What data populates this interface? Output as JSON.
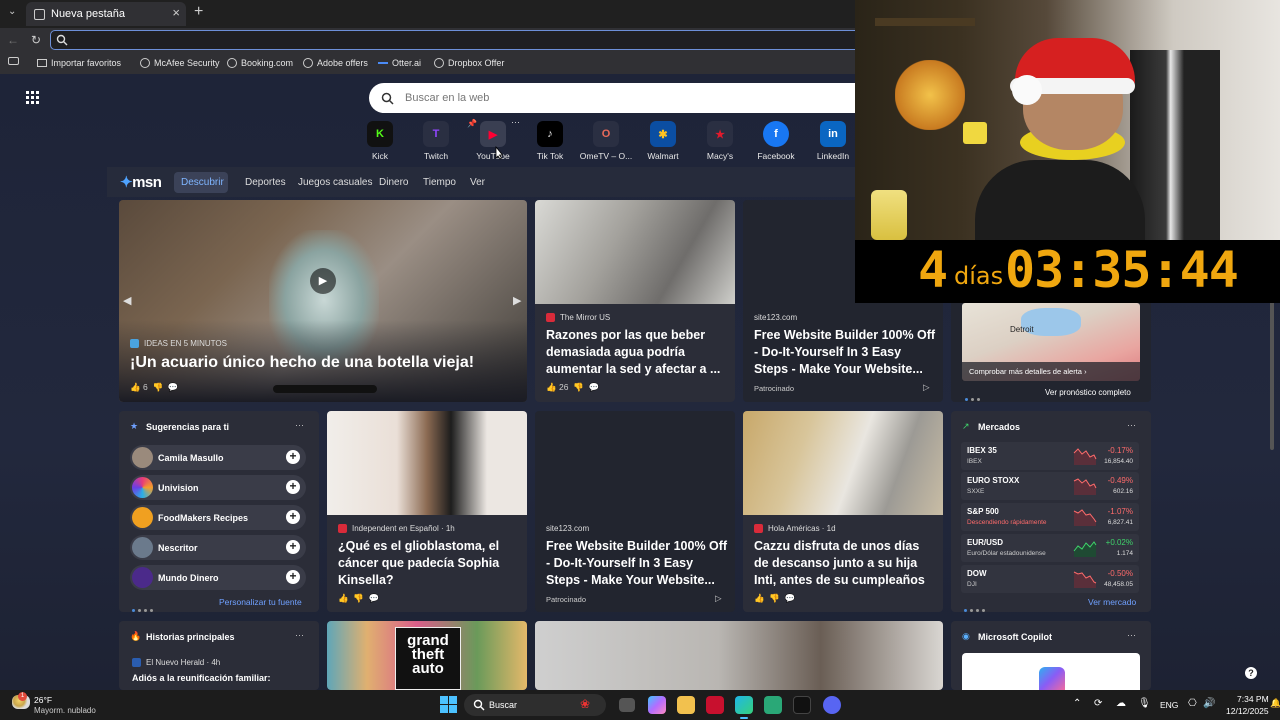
{
  "browser": {
    "tab_title": "Nueva pestaña",
    "new_tab": "+",
    "close_tab": "×",
    "address_value": "",
    "favorites": [
      "Importar favoritos",
      "McAfee Security",
      "Booking.com",
      "Adobe offers",
      "Otter.ai",
      "Dropbox Offer"
    ]
  },
  "newtab": {
    "search_placeholder": "Buscar en la web",
    "quick_links": [
      {
        "label": "Kick",
        "color": "#53fc18",
        "glyph": "K"
      },
      {
        "label": "Twitch",
        "color": "#9146ff",
        "glyph": "T"
      },
      {
        "label": "YouTube",
        "color": "#ff0033",
        "glyph": "▶"
      },
      {
        "label": "Tik Tok",
        "color": "#111111",
        "glyph": "♪"
      },
      {
        "label": "OmeTV – O...",
        "color": "#e86a5a",
        "glyph": "O"
      },
      {
        "label": "Walmart",
        "color": "#0071dc",
        "glyph": "✱"
      },
      {
        "label": "Macy's",
        "color": "#e21a2c",
        "glyph": "★"
      },
      {
        "label": "Facebook",
        "color": "#1877f2",
        "glyph": "f"
      },
      {
        "label": "LinkedIn",
        "color": "#0a66c2",
        "glyph": "in"
      }
    ]
  },
  "msn": {
    "logo": "msn",
    "nav": [
      "Descubrir",
      "Deportes",
      "Juegos casuales",
      "Dinero",
      "Tiempo",
      "Ver"
    ],
    "hero": {
      "source": "IDEAS EN 5 MINUTOS",
      "title": "¡Un acuario único hecho de una botella vieja!",
      "likes": "6"
    },
    "card_mirror": {
      "source": "The Mirror US",
      "title": "Razones por las que beber demasiada agua podría aumentar la sed y afectar a ...",
      "likes": "26"
    },
    "card_ad1": {
      "source": "site123.com",
      "title": "Free Website Builder 100% Off - Do-It-Yourself In 3 Easy Steps - Make Your Website...",
      "sponsored": "Patrocinado"
    },
    "weather": {
      "city": "Detroit",
      "alert": "Comprobar más detalles de alerta",
      "forecast": "Ver pronóstico completo"
    },
    "suggestions": {
      "title": "Sugerencias para ti",
      "items": [
        "Camila Masullo",
        "Univision",
        "FoodMakers Recipes",
        "Nescritor",
        "Mundo Dinero"
      ],
      "more": "Personalizar tu fuente"
    },
    "card_glio": {
      "source": "Independent en Español · 1h",
      "title": "¿Qué es el glioblastoma, el cáncer que padecía Sophia Kinsella?"
    },
    "card_ad2": {
      "source": "site123.com",
      "title": "Free Website Builder 100% Off - Do-It-Yourself In 3 Easy Steps - Make Your Website...",
      "sponsored": "Patrocinado"
    },
    "card_cazzu": {
      "source": "Hola Américas · 1d",
      "title": "Cazzu disfruta de unos días de descanso junto a su hija Inti, antes de su cumpleaños"
    },
    "markets": {
      "title": "Mercados",
      "items": [
        {
          "name": "IBEX 35",
          "sub": "IBEX",
          "change": "-0.17%",
          "value": "16,854.40",
          "color": "#ff6b6b"
        },
        {
          "name": "EURO STOXX",
          "sub": "SXXE",
          "change": "-0.49%",
          "value": "602.16",
          "color": "#ff6b6b"
        },
        {
          "name": "S&P 500",
          "sub": "Descendiendo rápidamente",
          "change": "-1.07%",
          "value": "6,827.41",
          "color": "#ff6b6b"
        },
        {
          "name": "EUR/USD",
          "sub": "Euro/Dólar estadounidense",
          "change": "+0.02%",
          "value": "1.174",
          "color": "#3fd46b"
        },
        {
          "name": "DOW",
          "sub": "DJI",
          "change": "-0.50%",
          "value": "48,458.05",
          "color": "#ff6b6b"
        }
      ],
      "more": "Ver mercado"
    },
    "top_stories": {
      "title": "Historias principales",
      "source": "El Nuevo Herald · 4h",
      "headline": "Adiós a la reunificación familiar:"
    },
    "gta_logo": "grand theft auto",
    "copilot": "Microsoft Copilot"
  },
  "overlay": {
    "countdown_days": "4",
    "countdown_unit": "días",
    "countdown_time": "03:35:44"
  },
  "taskbar": {
    "temp": "26°F",
    "weather": "Mayorm. nublado",
    "search": "Buscar",
    "lang": "ENG",
    "time": "7:34 PM",
    "date": "12/12/2025",
    "weather_badge": "1"
  }
}
